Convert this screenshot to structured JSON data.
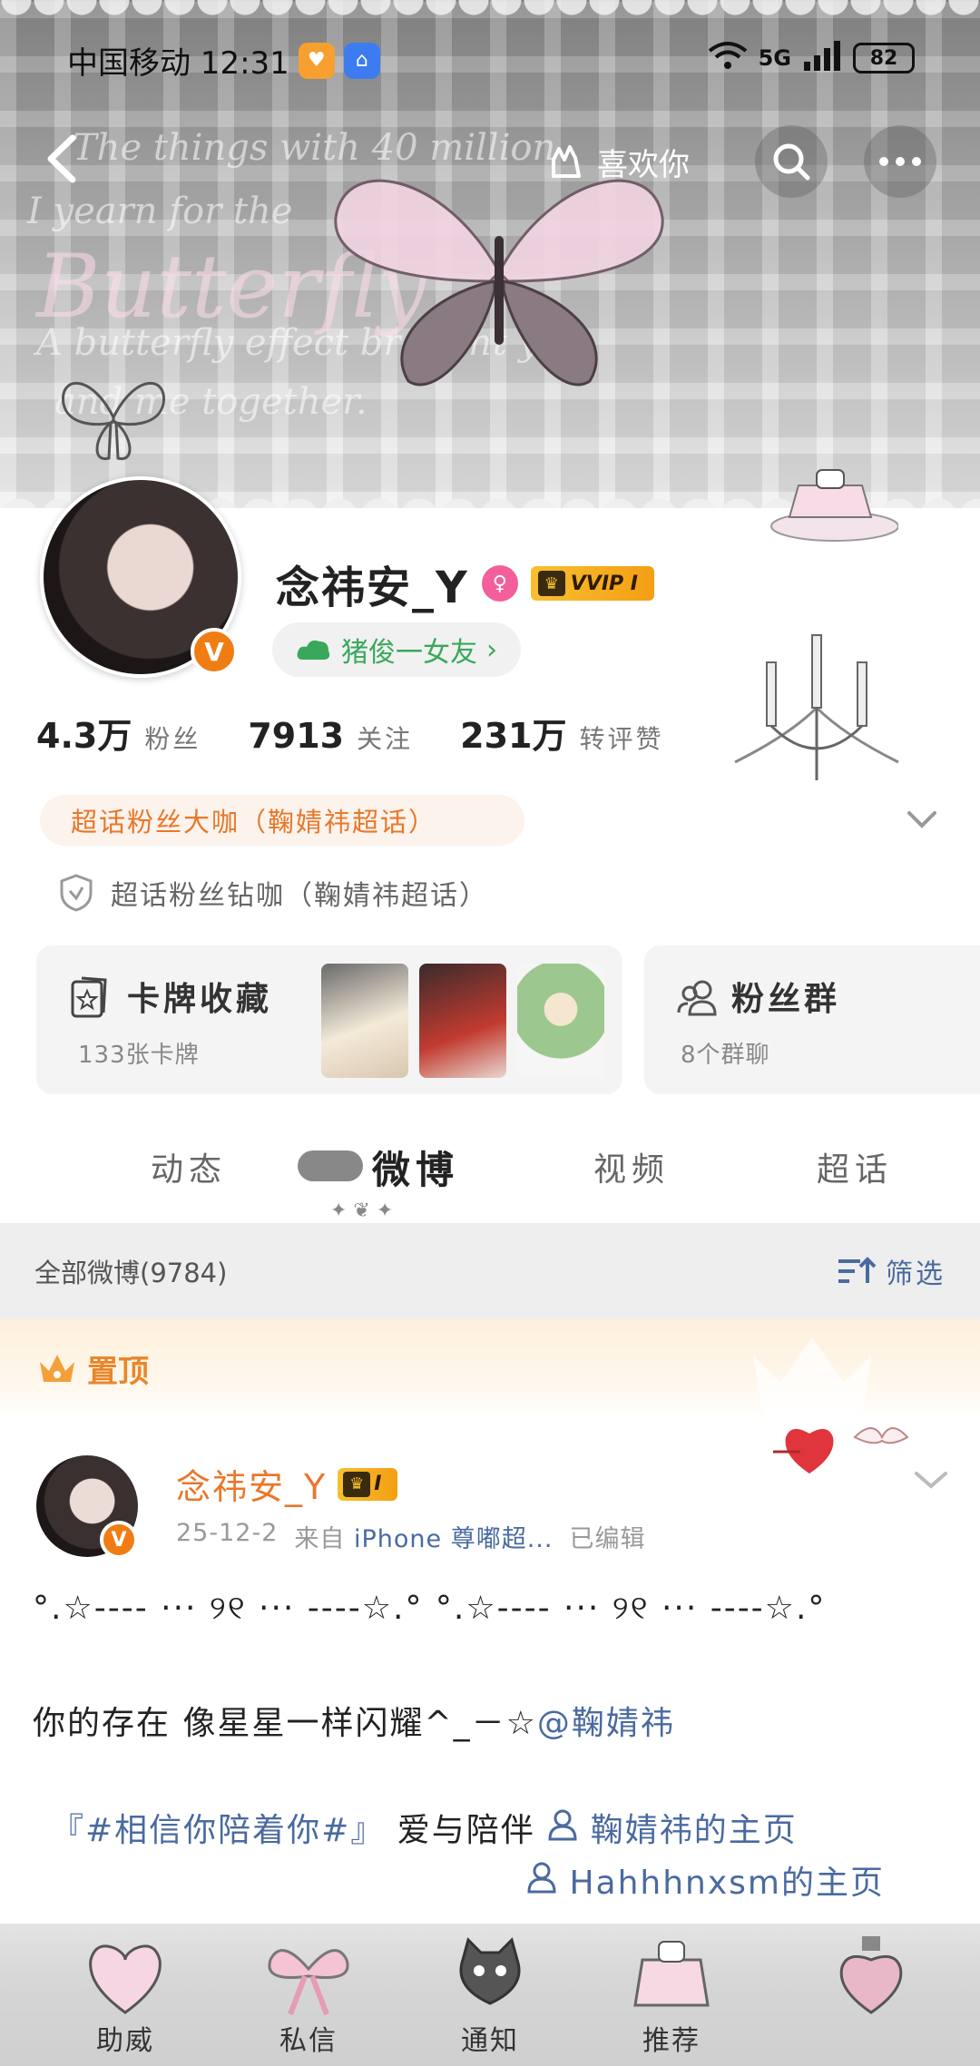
{
  "status_bar": {
    "carrier_time": "中国移动 12:31",
    "network": "5G",
    "battery": "82"
  },
  "header": {
    "like_label": "喜欢你",
    "banner_text": {
      "line1": "The things with 40 million",
      "line2": "I yearn for the",
      "line3": "Butterfly",
      "line4": "A butterfly effect brought you",
      "line5": "and me together."
    }
  },
  "profile": {
    "name": "念祎安_Y",
    "vip_label": "VVIP I",
    "fans_pill": "猪俊一女友",
    "stats": [
      {
        "value": "4.3万",
        "label": "粉丝"
      },
      {
        "value": "7913",
        "label": "关注"
      },
      {
        "value": "231万",
        "label": "转评赞"
      }
    ],
    "tag_primary": "超话粉丝大咖（鞠婧祎超话）",
    "tag_secondary": "超话粉丝钻咖（鞠婧祎超话）"
  },
  "cards": {
    "collection": {
      "title": "卡牌收藏",
      "subtitle": "133张卡牌"
    },
    "fan_group": {
      "title": "粉丝群",
      "subtitle": "8个群聊"
    }
  },
  "tabs": [
    "动态",
    "微博",
    "视频",
    "超话"
  ],
  "filter": {
    "all_label": "全部微博(9784)",
    "filter_label": "筛选"
  },
  "pinned": {
    "label": "置顶"
  },
  "post": {
    "author": "念祎安_Y",
    "vip_level": "I",
    "date": "25-12-2",
    "source_prefix": "来自",
    "source": "iPhone 尊嘟超...",
    "edited": "已编辑",
    "line1": "°.☆---- ··· ୨୧ ··· ----☆.° °.☆---- ··· ୨୧ ··· ----☆.°",
    "line2_text": "你的存在 像星星一样闪耀^_－☆",
    "line2_mention": "@鞠婧祎",
    "line3_topic": "『#相信你陪着你#』",
    "line3_text": " 爱与陪伴",
    "line3_link": "鞠婧祎的主页",
    "line4_link": "Hahhhnxsm的主页"
  },
  "bottom_nav": [
    "助威",
    "私信",
    "通知",
    "推荐",
    ""
  ],
  "colors": {
    "accent_orange": "#e9772a",
    "link_blue": "#4a6aa0",
    "vip_gold": "#f8c02e",
    "green": "#39a85a"
  }
}
